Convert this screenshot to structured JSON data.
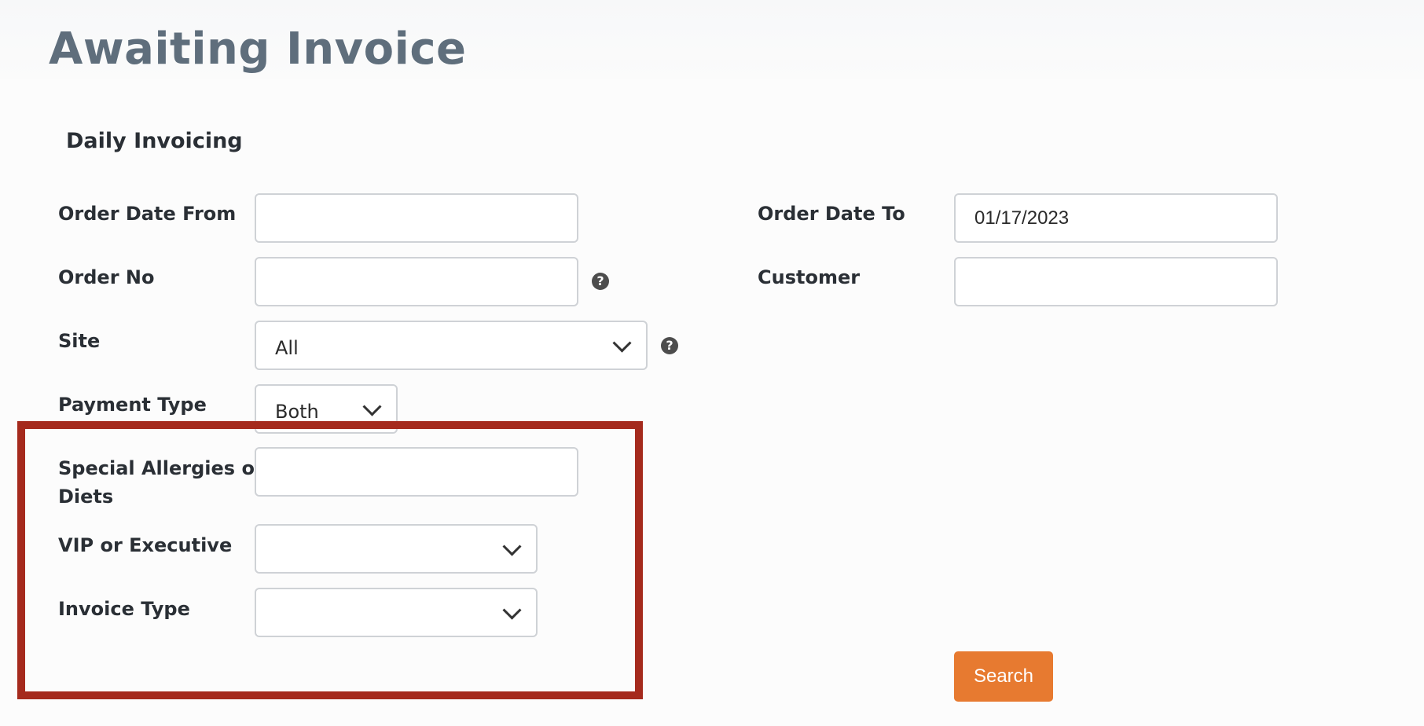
{
  "page": {
    "title": "Awaiting Invoice",
    "section": "Daily Invoicing"
  },
  "form": {
    "order_date_from": {
      "label": "Order Date From",
      "value": ""
    },
    "order_date_to": {
      "label": "Order Date To",
      "value": "01/17/2023"
    },
    "order_no": {
      "label": "Order No",
      "value": ""
    },
    "customer": {
      "label": "Customer",
      "value": ""
    },
    "site": {
      "label": "Site",
      "value": "All"
    },
    "payment_type": {
      "label": "Payment Type",
      "value": "Both"
    },
    "allergies": {
      "label_line1": "Special Allergies or",
      "label_line2": "Diets",
      "value": ""
    },
    "vip": {
      "label": "VIP or Executive",
      "value": ""
    },
    "invoice_type": {
      "label": "Invoice Type",
      "value": ""
    }
  },
  "help_icon_glyph": "?",
  "search": {
    "label": "Search"
  },
  "colors": {
    "highlight": "#a52a1d",
    "accent": "#e77a30",
    "title": "#5f6e7c"
  }
}
